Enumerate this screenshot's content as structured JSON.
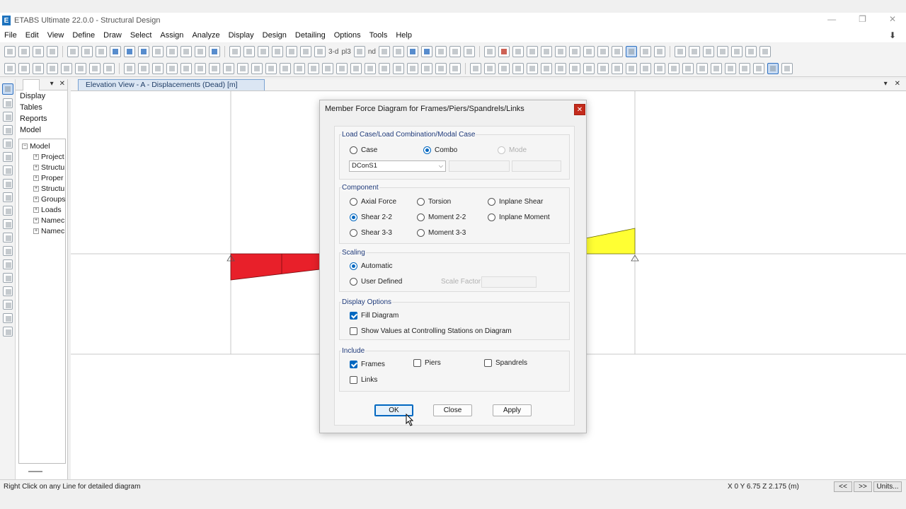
{
  "window": {
    "title": "ETABS Ultimate 22.0.0 - Structural Design",
    "app_icon_letter": "E",
    "min": "—",
    "restore": "❐",
    "close": "✕"
  },
  "menu": [
    "File",
    "Edit",
    "View",
    "Define",
    "Draw",
    "Select",
    "Assign",
    "Analyze",
    "Display",
    "Design",
    "Detailing",
    "Options",
    "Tools",
    "Help"
  ],
  "toolbar": {
    "view_3d_label": "3-d",
    "plan_label": "pl3",
    "nd_label": "nd"
  },
  "explorer": {
    "sections": [
      "Display",
      "Tables",
      "Reports",
      "Model"
    ],
    "tree_root": "Model",
    "tree_items": [
      "Project",
      "Structu",
      "Proper",
      "Structu",
      "Groups",
      "Loads",
      "Namec",
      "Namec"
    ],
    "pin": "▾",
    "close": "✕"
  },
  "document": {
    "tab_title": "Elevation View - A   - Displacements (Dead)  [m]",
    "pin": "▾",
    "close": "✕"
  },
  "colors": {
    "accent": "#0067c0",
    "diagram_red": "#e8202a",
    "diagram_yellow": "#ffff33",
    "close_red": "#c42b1c"
  },
  "dialog": {
    "title": "Member Force Diagram for Frames/Piers/Spandrels/Links",
    "close_icon": "✕",
    "load_case": {
      "label": "Load Case/Load Combination/Modal Case",
      "case": "Case",
      "combo": "Combo",
      "mode": "Mode",
      "selected": "combo",
      "combo_value": "DConS1"
    },
    "component": {
      "label": "Component",
      "options": [
        "Axial Force",
        "Torsion",
        "Inplane Shear",
        "Shear 2-2",
        "Moment 2-2",
        "Inplane Moment",
        "Shear 3-3",
        "Moment 3-3"
      ],
      "selected": "Shear 2-2"
    },
    "scaling": {
      "label": "Scaling",
      "automatic": "Automatic",
      "user_defined": "User Defined",
      "scale_factor": "Scale Factor",
      "selected": "automatic"
    },
    "display_options": {
      "label": "Display Options",
      "fill": "Fill Diagram",
      "fill_checked": true,
      "show_values": "Show Values at Controlling Stations on Diagram",
      "show_values_checked": false
    },
    "include": {
      "label": "Include",
      "frames": "Frames",
      "frames_checked": true,
      "piers": "Piers",
      "piers_checked": false,
      "spandrels": "Spandrels",
      "spandrels_checked": false,
      "links": "Links",
      "links_checked": false
    },
    "buttons": {
      "ok": "OK",
      "close": "Close",
      "apply": "Apply"
    }
  },
  "status": {
    "message": "Right Click on any Line for detailed diagram",
    "coords": "X 0  Y 6.75  Z 2.175 (m)",
    "prev": "<<",
    "next": ">>",
    "units": "Units..."
  }
}
